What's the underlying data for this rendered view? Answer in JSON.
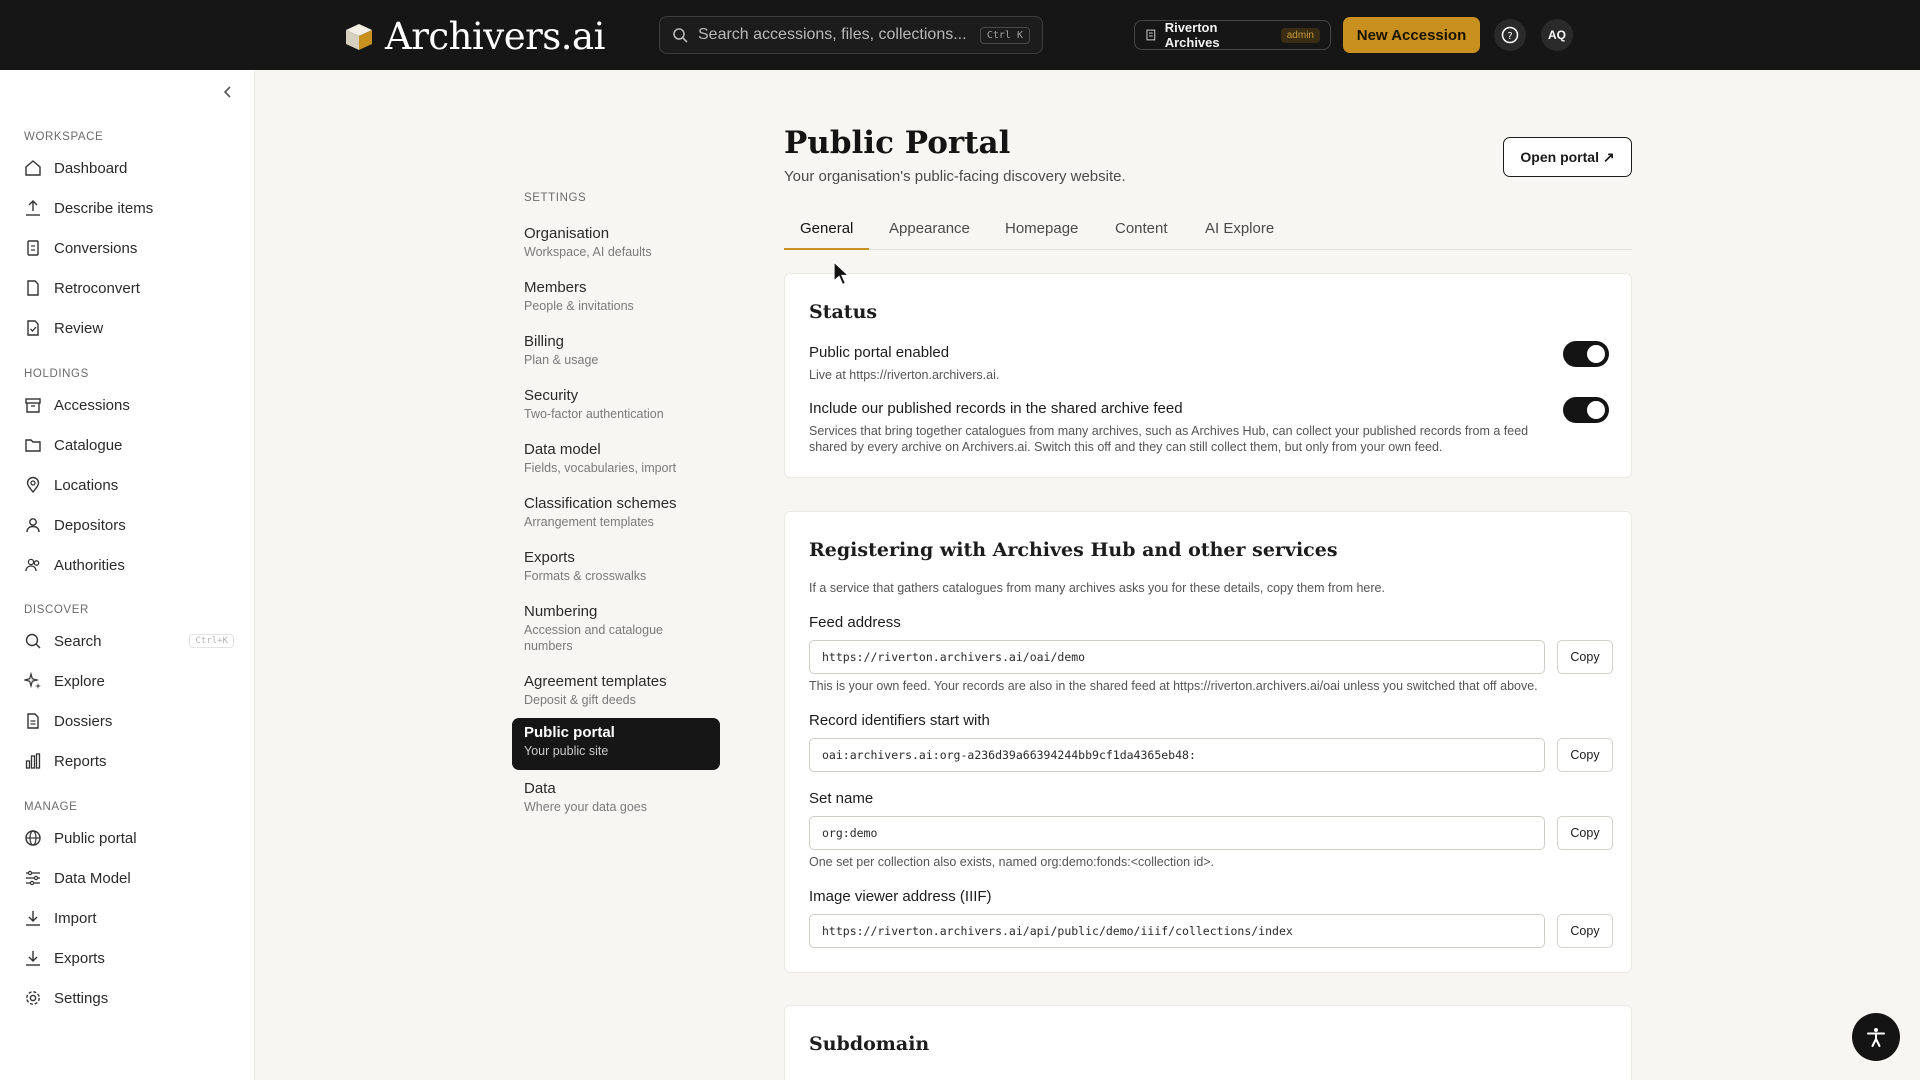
{
  "app": {
    "name": "Archivers.ai"
  },
  "search": {
    "placeholder": "Search accessions, files, collections...",
    "shortcut": "Ctrl K"
  },
  "topbar": {
    "archive_name": "Riverton Archives",
    "role_badge": "admin",
    "new_button": "New Accession",
    "avatar_initials": "AQ"
  },
  "colors": {
    "accent": "#c8901f",
    "topbar": "#161616",
    "toggle_on": "#141414"
  },
  "sidebar": {
    "sections": [
      {
        "title": "WORKSPACE",
        "items": [
          {
            "label": "Dashboard",
            "icon": "home-icon"
          },
          {
            "label": "Describe items",
            "icon": "upload-icon"
          },
          {
            "label": "Conversions",
            "icon": "convert-icon"
          },
          {
            "label": "Retroconvert",
            "icon": "document-icon"
          },
          {
            "label": "Review",
            "icon": "review-icon"
          }
        ]
      },
      {
        "title": "HOLDINGS",
        "items": [
          {
            "label": "Accessions",
            "icon": "archive-box-icon"
          },
          {
            "label": "Catalogue",
            "icon": "folder-icon"
          },
          {
            "label": "Locations",
            "icon": "map-pin-icon"
          },
          {
            "label": "Depositors",
            "icon": "person-icon"
          },
          {
            "label": "Authorities",
            "icon": "people-icon"
          }
        ]
      },
      {
        "title": "DISCOVER",
        "items": [
          {
            "label": "Search",
            "icon": "search-icon",
            "shortcut": "Ctrl+K"
          },
          {
            "label": "Explore",
            "icon": "sparkle-icon"
          },
          {
            "label": "Dossiers",
            "icon": "document-icon"
          },
          {
            "label": "Reports",
            "icon": "bar-chart-icon"
          }
        ]
      },
      {
        "title": "MANAGE",
        "items": [
          {
            "label": "Public portal",
            "icon": "globe-icon"
          },
          {
            "label": "Data Model",
            "icon": "sliders-icon"
          },
          {
            "label": "Import",
            "icon": "download-icon"
          },
          {
            "label": "Exports",
            "icon": "download-icon"
          },
          {
            "label": "Settings",
            "icon": "gear-icon"
          }
        ]
      }
    ]
  },
  "settings_nav": {
    "title": "SETTINGS",
    "items": [
      {
        "label": "Organisation",
        "sub": "Workspace, AI defaults"
      },
      {
        "label": "Members",
        "sub": "People & invitations"
      },
      {
        "label": "Billing",
        "sub": "Plan & usage"
      },
      {
        "label": "Security",
        "sub": "Two-factor authentication"
      },
      {
        "label": "Data model",
        "sub": "Fields, vocabularies, import"
      },
      {
        "label": "Classification schemes",
        "sub": "Arrangement templates"
      },
      {
        "label": "Exports",
        "sub": "Formats & crosswalks"
      },
      {
        "label": "Numbering",
        "sub": "Accession and catalogue numbers"
      },
      {
        "label": "Agreement templates",
        "sub": "Deposit & gift deeds"
      },
      {
        "label": "Public portal",
        "sub": "Your public site",
        "active": true
      },
      {
        "label": "Data",
        "sub": "Where your data goes"
      }
    ]
  },
  "main": {
    "title": "Public Portal",
    "subtitle": "Your organisation's public-facing discovery website.",
    "open_button": "Open portal ↗",
    "tabs": [
      "General",
      "Appearance",
      "Homepage",
      "Content",
      "AI Explore"
    ],
    "active_tab": "General",
    "status": {
      "heading": "Status",
      "portal_enabled": {
        "title": "Public portal enabled",
        "desc": "Live at https://riverton.archivers.ai.",
        "on": true
      },
      "shared_feed": {
        "title": "Include our published records in the shared archive feed",
        "desc": "Services that bring together catalogues from many archives, such as Archives Hub, can collect your published records from a feed shared by every archive on Archivers.ai. Switch this off and they can still collect them, but only from your own feed.",
        "on": true
      }
    },
    "registering": {
      "heading": "Registering with Archives Hub and other services",
      "intro": "If a service that gathers catalogues from many archives asks you for these details, copy them from here.",
      "copy_label": "Copy",
      "feed": {
        "label": "Feed address",
        "value": "https://riverton.archivers.ai/oai/demo",
        "help": "This is your own feed. Your records are also in the shared feed at https://riverton.archivers.ai/oai unless you switched that off above."
      },
      "identifiers": {
        "label": "Record identifiers start with",
        "value": "oai:archivers.ai:org-a236d39a66394244bb9cf1da4365eb48:"
      },
      "set_name": {
        "label": "Set name",
        "value": "org:demo",
        "help": "One set per collection also exists, named org:demo:fonds:<collection id>."
      },
      "iiif": {
        "label": "Image viewer address (IIIF)",
        "value": "https://riverton.archivers.ai/api/public/demo/iiif/collections/index"
      }
    },
    "subdomain": {
      "heading": "Subdomain"
    }
  }
}
